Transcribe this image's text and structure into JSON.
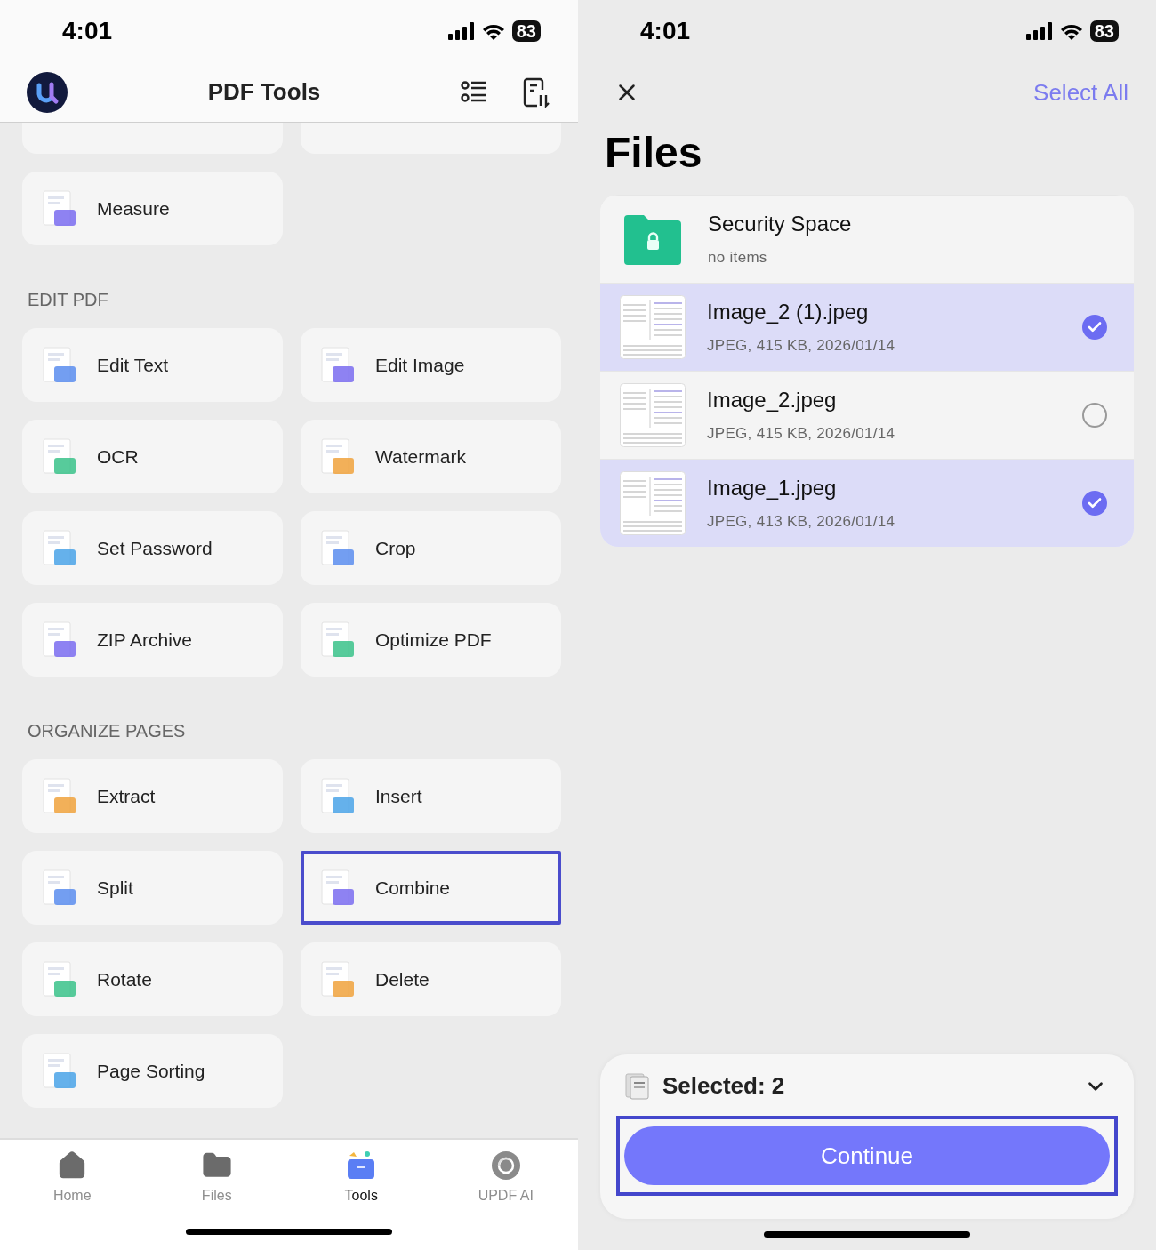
{
  "tools_screen": {
    "status_bar": {
      "time": "4:01",
      "battery": "83"
    },
    "header": {
      "title": "PDF Tools"
    },
    "top_tools": [
      {
        "label": "Measure",
        "highlighted": false
      }
    ],
    "sections": [
      {
        "title": "EDIT PDF",
        "tools": [
          {
            "label": "Edit Text",
            "highlighted": false
          },
          {
            "label": "Edit Image",
            "highlighted": false
          },
          {
            "label": "OCR",
            "highlighted": false
          },
          {
            "label": "Watermark",
            "highlighted": false
          },
          {
            "label": "Set Password",
            "highlighted": false
          },
          {
            "label": "Crop",
            "highlighted": false
          },
          {
            "label": "ZIP Archive",
            "highlighted": false
          },
          {
            "label": "Optimize PDF",
            "highlighted": false
          }
        ]
      },
      {
        "title": "ORGANIZE PAGES",
        "tools": [
          {
            "label": "Extract",
            "highlighted": false
          },
          {
            "label": "Insert",
            "highlighted": false
          },
          {
            "label": "Split",
            "highlighted": false
          },
          {
            "label": "Combine",
            "highlighted": true
          },
          {
            "label": "Rotate",
            "highlighted": false
          },
          {
            "label": "Delete",
            "highlighted": false
          },
          {
            "label": "Page Sorting",
            "highlighted": false
          }
        ]
      }
    ],
    "tab_bar": [
      {
        "kind": "home",
        "label": "Home",
        "selected": false
      },
      {
        "kind": "files",
        "label": "Files",
        "selected": false
      },
      {
        "kind": "tools",
        "label": "Tools",
        "selected": true
      },
      {
        "kind": "ai",
        "label": "UPDF AI",
        "selected": false
      }
    ]
  },
  "files_screen": {
    "status_bar": {
      "time": "4:01",
      "battery": "83"
    },
    "select_all": "Select All",
    "title": "Files",
    "items": [
      {
        "kind": "folder",
        "name": "Security Space",
        "details": "no items"
      },
      {
        "kind": "file",
        "name": "Image_2 (1).jpeg",
        "details": "JPEG, 415 KB, 2026/01/14",
        "selected": true
      },
      {
        "kind": "file",
        "name": "Image_2.jpeg",
        "details": "JPEG, 415 KB, 2026/01/14",
        "selected": false
      },
      {
        "kind": "file",
        "name": "Image_1.jpeg",
        "details": "JPEG, 413 KB, 2026/01/14",
        "selected": true
      }
    ],
    "sheet": {
      "selected_label": "Selected: 2",
      "continue": {
        "label": "Continue",
        "highlighted": true
      }
    }
  }
}
